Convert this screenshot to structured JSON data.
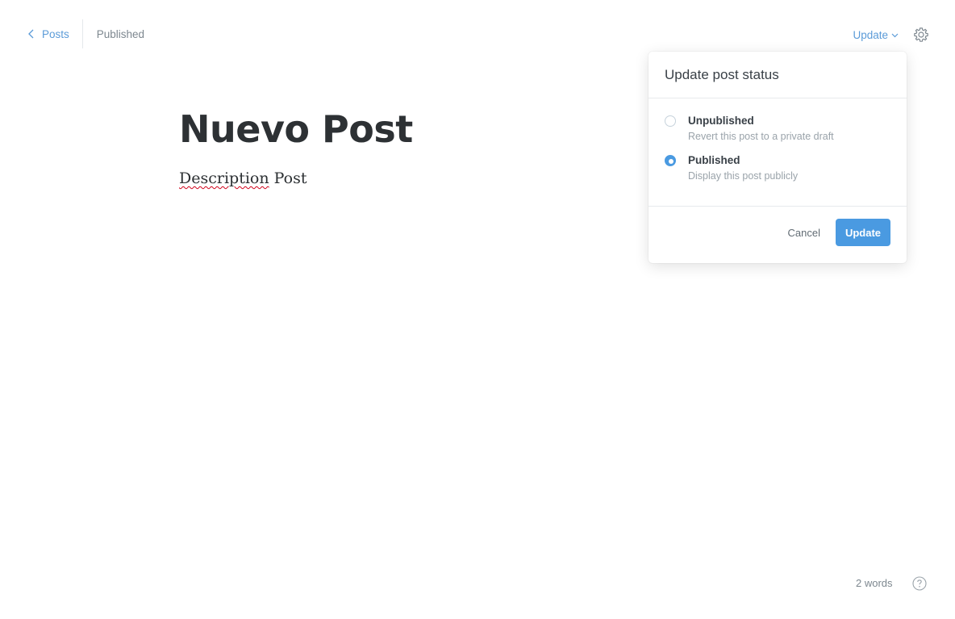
{
  "header": {
    "back_label": "Posts",
    "status": "Published",
    "update_label": "Update"
  },
  "editor": {
    "title": "Nuevo Post",
    "body_word1": "Description",
    "body_word2": " Post"
  },
  "popover": {
    "title": "Update post status",
    "options": [
      {
        "label": "Unpublished",
        "description": "Revert this post to a private draft",
        "selected": false
      },
      {
        "label": "Published",
        "description": "Display this post publicly",
        "selected": true
      }
    ],
    "cancel_label": "Cancel",
    "update_label": "Update"
  },
  "footer": {
    "word_count": "2 words"
  },
  "icons": {
    "back": "chevron-left-icon",
    "dropdown": "chevron-down-icon",
    "settings": "gear-icon",
    "help": "question-circle-icon"
  },
  "colors": {
    "accent": "#4a9ae1",
    "link": "#5b9bd8",
    "muted": "#7d878f"
  }
}
